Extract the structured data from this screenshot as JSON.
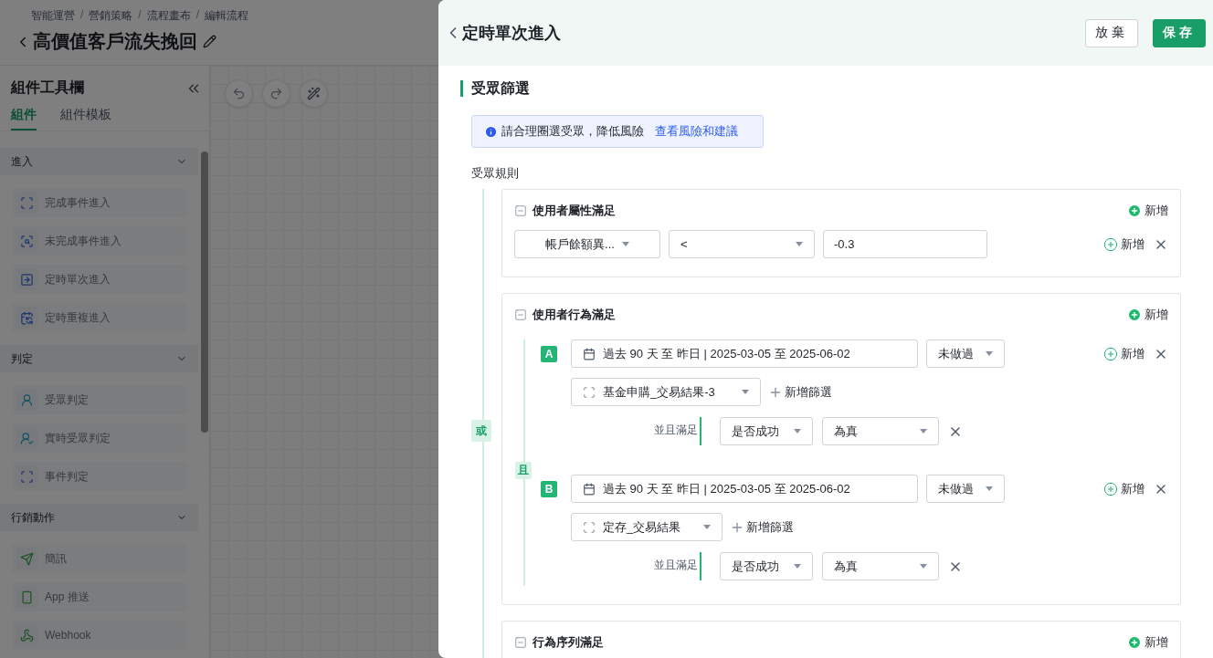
{
  "breadcrumb": {
    "items": [
      "智能運營",
      "營銷策略",
      "流程畫布",
      "編輯流程"
    ],
    "separator": "/"
  },
  "page_title": "高價值客戶流失挽回",
  "toolbar": {
    "title": "組件工具欄",
    "tabs": [
      {
        "label": "組件",
        "selected": true
      },
      {
        "label": "組件模板",
        "selected": false
      }
    ],
    "groups": [
      {
        "title": "進入",
        "expanded": true,
        "items": [
          {
            "label": "完成事件進入",
            "kind": "event"
          },
          {
            "label": "未完成事件進入",
            "kind": "missed"
          },
          {
            "label": "定時單次進入",
            "kind": "once"
          },
          {
            "label": "定時重複進入",
            "kind": "repeat"
          }
        ]
      },
      {
        "title": "判定",
        "expanded": true,
        "items": [
          {
            "label": "受眾判定",
            "kind": "audience"
          },
          {
            "label": "實時受眾判定",
            "kind": "realtime"
          },
          {
            "label": "事件判定",
            "kind": "event"
          }
        ]
      },
      {
        "title": "行銷動作",
        "expanded": true,
        "items": [
          {
            "label": "簡訊",
            "kind": "sms"
          },
          {
            "label": "App 推送",
            "kind": "push"
          },
          {
            "label": "Webhook",
            "kind": "webhook"
          }
        ]
      }
    ]
  },
  "drawer": {
    "title": "定時單次進入",
    "buttons": [
      {
        "label": "放棄",
        "kind": "secondary"
      },
      {
        "label": "保存",
        "kind": "primary"
      }
    ],
    "section_title": "受眾篩選",
    "notice": {
      "text": "請合理圈選受眾，降低風險",
      "link": "查看風險和建議"
    },
    "rules_label": "受眾規則",
    "logic": "或",
    "groups": [
      {
        "kind": "attribute",
        "title": "使用者屬性滿足",
        "expanded": true,
        "add": "新增",
        "conditions": [
          {
            "field": "帳戶餘額異...",
            "operator": "<",
            "value": "-0.3",
            "add": "新增"
          }
        ]
      },
      {
        "kind": "behavior",
        "title": "使用者行為滿足",
        "expanded": true,
        "add": "新增",
        "logic": "且",
        "behaviors": [
          {
            "letter": "A",
            "time": "過去 90 天 至 昨日 | 2025-03-05 至 2025-06-02",
            "action": "未做過",
            "add": "新增",
            "event": "基金申購_交易結果-3",
            "add_filter": "新增篩選",
            "filter_label": "並且滿足",
            "filters": [
              {
                "field": "是否成功",
                "value": "為真"
              }
            ]
          },
          {
            "letter": "B",
            "time": "過去 90 天 至 昨日 | 2025-03-05 至 2025-06-02",
            "action": "未做過",
            "add": "新增",
            "event": "定存_交易結果",
            "add_filter": "新增篩選",
            "filter_label": "並且滿足",
            "filters": [
              {
                "field": "是否成功",
                "value": "為真"
              }
            ]
          }
        ]
      },
      {
        "kind": "sequence",
        "title": "行為序列滿足",
        "expanded": true,
        "add": "新增"
      }
    ]
  }
}
